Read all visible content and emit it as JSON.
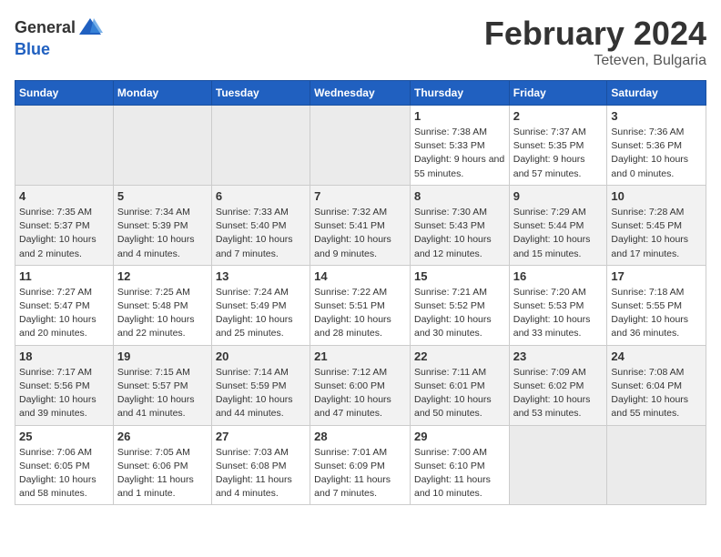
{
  "header": {
    "logo_general": "General",
    "logo_blue": "Blue",
    "title": "February 2024",
    "location": "Teteven, Bulgaria"
  },
  "calendar": {
    "weekdays": [
      "Sunday",
      "Monday",
      "Tuesday",
      "Wednesday",
      "Thursday",
      "Friday",
      "Saturday"
    ],
    "weeks": [
      [
        {
          "day": "",
          "empty": true
        },
        {
          "day": "",
          "empty": true
        },
        {
          "day": "",
          "empty": true
        },
        {
          "day": "",
          "empty": true
        },
        {
          "day": "1",
          "sunrise": "7:38 AM",
          "sunset": "5:33 PM",
          "daylight": "9 hours and 55 minutes."
        },
        {
          "day": "2",
          "sunrise": "7:37 AM",
          "sunset": "5:35 PM",
          "daylight": "9 hours and 57 minutes."
        },
        {
          "day": "3",
          "sunrise": "7:36 AM",
          "sunset": "5:36 PM",
          "daylight": "10 hours and 0 minutes."
        }
      ],
      [
        {
          "day": "4",
          "sunrise": "7:35 AM",
          "sunset": "5:37 PM",
          "daylight": "10 hours and 2 minutes."
        },
        {
          "day": "5",
          "sunrise": "7:34 AM",
          "sunset": "5:39 PM",
          "daylight": "10 hours and 4 minutes."
        },
        {
          "day": "6",
          "sunrise": "7:33 AM",
          "sunset": "5:40 PM",
          "daylight": "10 hours and 7 minutes."
        },
        {
          "day": "7",
          "sunrise": "7:32 AM",
          "sunset": "5:41 PM",
          "daylight": "10 hours and 9 minutes."
        },
        {
          "day": "8",
          "sunrise": "7:30 AM",
          "sunset": "5:43 PM",
          "daylight": "10 hours and 12 minutes."
        },
        {
          "day": "9",
          "sunrise": "7:29 AM",
          "sunset": "5:44 PM",
          "daylight": "10 hours and 15 minutes."
        },
        {
          "day": "10",
          "sunrise": "7:28 AM",
          "sunset": "5:45 PM",
          "daylight": "10 hours and 17 minutes."
        }
      ],
      [
        {
          "day": "11",
          "sunrise": "7:27 AM",
          "sunset": "5:47 PM",
          "daylight": "10 hours and 20 minutes."
        },
        {
          "day": "12",
          "sunrise": "7:25 AM",
          "sunset": "5:48 PM",
          "daylight": "10 hours and 22 minutes."
        },
        {
          "day": "13",
          "sunrise": "7:24 AM",
          "sunset": "5:49 PM",
          "daylight": "10 hours and 25 minutes."
        },
        {
          "day": "14",
          "sunrise": "7:22 AM",
          "sunset": "5:51 PM",
          "daylight": "10 hours and 28 minutes."
        },
        {
          "day": "15",
          "sunrise": "7:21 AM",
          "sunset": "5:52 PM",
          "daylight": "10 hours and 30 minutes."
        },
        {
          "day": "16",
          "sunrise": "7:20 AM",
          "sunset": "5:53 PM",
          "daylight": "10 hours and 33 minutes."
        },
        {
          "day": "17",
          "sunrise": "7:18 AM",
          "sunset": "5:55 PM",
          "daylight": "10 hours and 36 minutes."
        }
      ],
      [
        {
          "day": "18",
          "sunrise": "7:17 AM",
          "sunset": "5:56 PM",
          "daylight": "10 hours and 39 minutes."
        },
        {
          "day": "19",
          "sunrise": "7:15 AM",
          "sunset": "5:57 PM",
          "daylight": "10 hours and 41 minutes."
        },
        {
          "day": "20",
          "sunrise": "7:14 AM",
          "sunset": "5:59 PM",
          "daylight": "10 hours and 44 minutes."
        },
        {
          "day": "21",
          "sunrise": "7:12 AM",
          "sunset": "6:00 PM",
          "daylight": "10 hours and 47 minutes."
        },
        {
          "day": "22",
          "sunrise": "7:11 AM",
          "sunset": "6:01 PM",
          "daylight": "10 hours and 50 minutes."
        },
        {
          "day": "23",
          "sunrise": "7:09 AM",
          "sunset": "6:02 PM",
          "daylight": "10 hours and 53 minutes."
        },
        {
          "day": "24",
          "sunrise": "7:08 AM",
          "sunset": "6:04 PM",
          "daylight": "10 hours and 55 minutes."
        }
      ],
      [
        {
          "day": "25",
          "sunrise": "7:06 AM",
          "sunset": "6:05 PM",
          "daylight": "10 hours and 58 minutes."
        },
        {
          "day": "26",
          "sunrise": "7:05 AM",
          "sunset": "6:06 PM",
          "daylight": "11 hours and 1 minute."
        },
        {
          "day": "27",
          "sunrise": "7:03 AM",
          "sunset": "6:08 PM",
          "daylight": "11 hours and 4 minutes."
        },
        {
          "day": "28",
          "sunrise": "7:01 AM",
          "sunset": "6:09 PM",
          "daylight": "11 hours and 7 minutes."
        },
        {
          "day": "29",
          "sunrise": "7:00 AM",
          "sunset": "6:10 PM",
          "daylight": "11 hours and 10 minutes."
        },
        {
          "day": "",
          "empty": true
        },
        {
          "day": "",
          "empty": true
        }
      ]
    ]
  }
}
